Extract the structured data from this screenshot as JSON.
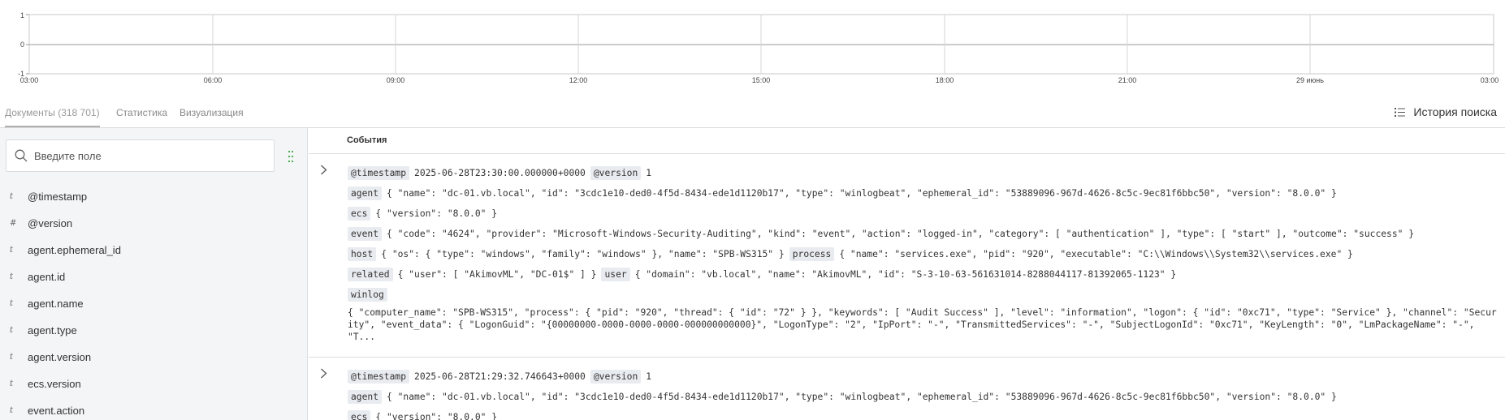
{
  "histogram": {
    "y_ticks": [
      "1",
      "0",
      "-1"
    ],
    "x_ticks": [
      "03:00",
      "06:00",
      "09:00",
      "12:00",
      "15:00",
      "18:00",
      "21:00",
      "29 июнь",
      "03:00"
    ]
  },
  "tabs": [
    {
      "label": "Документы (318 701)",
      "active": true
    },
    {
      "label": "Статистика",
      "active": false
    },
    {
      "label": "Визуализация",
      "active": false
    }
  ],
  "history_button": {
    "label": "История поиска",
    "icon": "list-icon"
  },
  "sidebar": {
    "search": {
      "placeholder": "Введите поле",
      "value": ""
    },
    "fields": [
      {
        "type": "t",
        "name": "@timestamp"
      },
      {
        "type": "#",
        "name": "@version"
      },
      {
        "type": "t",
        "name": "agent.ephemeral_id"
      },
      {
        "type": "t",
        "name": "agent.id"
      },
      {
        "type": "t",
        "name": "agent.name"
      },
      {
        "type": "t",
        "name": "agent.type"
      },
      {
        "type": "t",
        "name": "agent.version"
      },
      {
        "type": "t",
        "name": "ecs.version"
      },
      {
        "type": "t",
        "name": "event.action"
      }
    ]
  },
  "main": {
    "header": "События",
    "events": [
      {
        "timestamp_key": "@timestamp",
        "timestamp": "2025-06-28T23:30:00.000000+0000",
        "version_key": "@version",
        "version": "1",
        "agent_key": "agent",
        "agent": "{ \"name\": \"dc-01.vb.local\", \"id\": \"3cdc1e10-ded0-4f5d-8434-ede1d1120b17\", \"type\": \"winlogbeat\", \"ephemeral_id\": \"53889096-967d-4626-8c5c-9ec81f6bbc50\", \"version\": \"8.0.0\" }",
        "ecs_key": "ecs",
        "ecs": "{ \"version\": \"8.0.0\" }",
        "event_key": "event",
        "event": "{ \"code\": \"4624\", \"provider\": \"Microsoft-Windows-Security-Auditing\", \"kind\": \"event\", \"action\": \"logged-in\", \"category\": [ \"authentication\" ], \"type\": [ \"start\" ], \"outcome\": \"success\" }",
        "host_key": "host",
        "host": "{ \"os\": { \"type\": \"windows\", \"family\": \"windows\" }, \"name\": \"SPB-WS315\" }",
        "process_key": "process",
        "process": "{ \"name\": \"services.exe\", \"pid\": \"920\", \"executable\": \"C:\\\\Windows\\\\System32\\\\services.exe\" }",
        "related_key": "related",
        "related": "{ \"user\": [ \"AkimovML\", \"DC-01$\" ] }",
        "user_key": "user",
        "user": "{ \"domain\": \"vb.local\", \"name\": \"AkimovML\", \"id\": \"S-3-10-63-561631014-8288044117-81392065-1123\" }",
        "winlog_key": "winlog",
        "winlog": "{ \"computer_name\": \"SPB-WS315\", \"process\": { \"pid\": \"920\", \"thread\": { \"id\": \"72\" } }, \"keywords\": [ \"Audit Success\" ], \"level\": \"information\", \"logon\": { \"id\": \"0xc71\", \"type\": \"Service\" }, \"channel\": \"Security\", \"event_data\": { \"LogonGuid\": \"{00000000-0000-0000-0000-000000000000}\", \"LogonType\": \"2\", \"IpPort\": \"-\", \"TransmittedServices\": \"-\", \"SubjectLogonId\": \"0xc71\", \"KeyLength\": \"0\", \"LmPackageName\": \"-\", \"T..."
      },
      {
        "timestamp_key": "@timestamp",
        "timestamp": "2025-06-28T21:29:32.746643+0000",
        "version_key": "@version",
        "version": "1",
        "agent_key": "agent",
        "agent": "{ \"name\": \"dc-01.vb.local\", \"id\": \"3cdc1e10-ded0-4f5d-8434-ede1d1120b17\", \"type\": \"winlogbeat\", \"ephemeral_id\": \"53889096-967d-4626-8c5c-9ec81f6bbc50\", \"version\": \"8.0.0\" }",
        "ecs_key": "ecs",
        "ecs": "{ \"version\": \"8.0.0\" }"
      }
    ]
  }
}
